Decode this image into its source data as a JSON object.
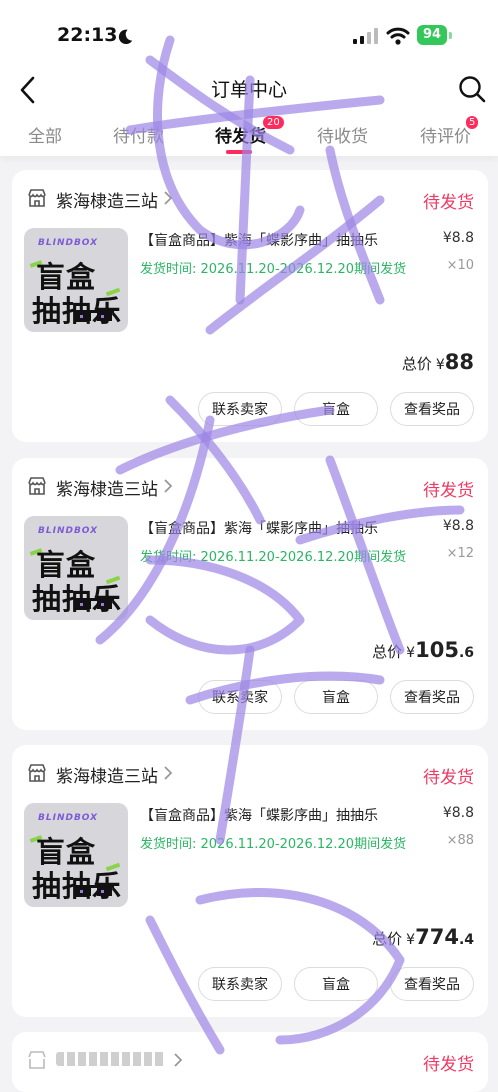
{
  "status_bar": {
    "time": "22:13",
    "battery": "94"
  },
  "nav": {
    "title": "订单中心"
  },
  "tabs": [
    {
      "label": "全部"
    },
    {
      "label": "待付款"
    },
    {
      "label": "待发货",
      "badge": "20"
    },
    {
      "label": "待收货"
    },
    {
      "label": "待评价",
      "badge": "5"
    }
  ],
  "orders": [
    {
      "shop": "紫海棣造三站",
      "status": "待发货",
      "thumb": {
        "brand": "BLINDBOX",
        "line1": "盲盒",
        "line2": "抽抽乐"
      },
      "title": "【盲盒商品】紫海「蝶影序曲」抽抽乐",
      "price": "¥8.8",
      "ship": "发货时间: 2026.11.20-2026.12.20期间发货",
      "qty": "×10",
      "total_label": "总价",
      "total_currency": "¥",
      "total_int": "88",
      "total_dec": "",
      "buttons": [
        "联系卖家",
        "盲盒",
        "查看奖品"
      ]
    },
    {
      "shop": "紫海棣造三站",
      "status": "待发货",
      "thumb": {
        "brand": "BLINDBOX",
        "line1": "盲盒",
        "line2": "抽抽乐"
      },
      "title": "【盲盒商品】紫海「蝶影序曲」抽抽乐",
      "price": "¥8.8",
      "ship": "发货时间: 2026.11.20-2026.12.20期间发货",
      "qty": "×12",
      "total_label": "总价",
      "total_currency": "¥",
      "total_int": "105",
      "total_dec": ".6",
      "buttons": [
        "联系卖家",
        "盲盒",
        "查看奖品"
      ]
    },
    {
      "shop": "紫海棣造三站",
      "status": "待发货",
      "thumb": {
        "brand": "BLINDBOX",
        "line1": "盲盒",
        "line2": "抽抽乐"
      },
      "title": "【盲盒商品】紫海「蝶影序曲」抽抽乐",
      "price": "¥8.8",
      "ship": "发货时间: 2026.11.20-2026.12.20期间发货",
      "qty": "×88",
      "total_label": "总价",
      "total_currency": "¥",
      "total_int": "774",
      "total_dec": ".4",
      "buttons": [
        "联系卖家",
        "盲盒",
        "查看奖品"
      ]
    },
    {
      "shop": "",
      "status": "待发货"
    }
  ],
  "colors": {
    "accent": "#ff2b5c",
    "status": "#ee3a64",
    "ship": "#2bb564",
    "watermark": "#9c86e6"
  }
}
